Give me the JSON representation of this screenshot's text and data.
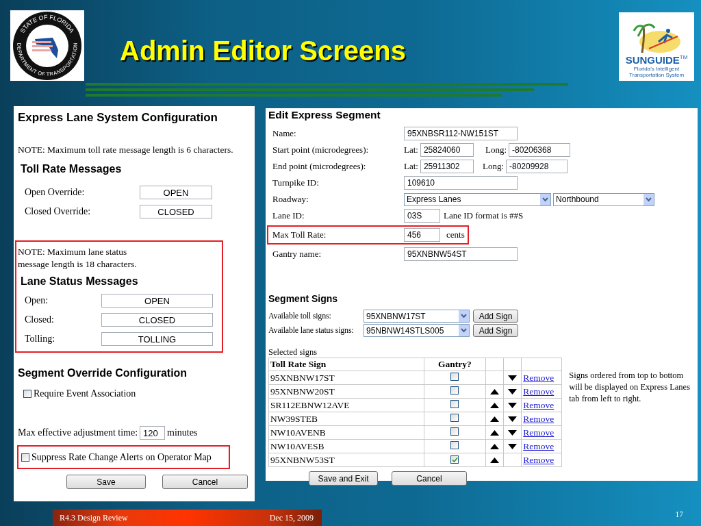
{
  "slide": {
    "title": "Admin Editor Screens",
    "footer_left": "R4.3 Design Review",
    "footer_date": "Dec 15, 2009",
    "page_number": "17"
  },
  "logos": {
    "left": {
      "top_text": "STATE OF FLORIDA",
      "bottom_text": "DEPARTMENT OF TRANSPORTATION"
    },
    "right": {
      "name": "SUNGUIDE",
      "trademark": "TM",
      "tagline": "Florida's Intelligent Transportation System"
    }
  },
  "system_config": {
    "title": "Express Lane System Configuration",
    "toll_note": "NOTE: Maximum toll rate message length is 6 characters.",
    "toll_heading": "Toll Rate Messages",
    "toll_messages": [
      {
        "label": "Open Override:",
        "value": "OPEN"
      },
      {
        "label": "Closed Override:",
        "value": "CLOSED"
      }
    ],
    "lane_highlighted": true,
    "lane_note": "NOTE: Maximum lane status message length is 18 characters.",
    "lane_heading": "Lane Status Messages",
    "lane_messages": [
      {
        "label": "Open:",
        "value": "OPEN"
      },
      {
        "label": "Closed:",
        "value": "CLOSED"
      },
      {
        "label": "Tolling:",
        "value": "TOLLING"
      }
    ],
    "override_heading": "Segment Override Configuration",
    "require_event": {
      "label": "Require Event Association",
      "checked": false
    },
    "adjust": {
      "label": "Max effective adjustment time:",
      "value": "120",
      "unit": "minutes"
    },
    "suppress": {
      "label": "Suppress Rate Change Alerts on Operator Map",
      "checked": false,
      "highlighted": true
    },
    "buttons": [
      "Save",
      "Cancel"
    ]
  },
  "segment": {
    "title": "Edit Express Segment",
    "fields": [
      {
        "kind": "text",
        "label": "Name:",
        "value": "95XNBSR112-NW151ST"
      },
      {
        "kind": "latlong",
        "label": "Start point (microdegrees):",
        "lat_label": "Lat:",
        "lat": "25824060",
        "long_label": "Long:",
        "long": "-80206368"
      },
      {
        "kind": "latlong",
        "label": "End point (microdegrees):",
        "lat_label": "Lat:",
        "lat": "25911302",
        "long_label": "Long:",
        "long": "-80209928"
      },
      {
        "kind": "text",
        "label": "Turnpike ID:",
        "value": "109610"
      },
      {
        "kind": "selects",
        "label": "Roadway:",
        "values": [
          "Express Lanes",
          "Northbound"
        ]
      },
      {
        "kind": "short",
        "label": "Lane ID:",
        "value": "03S",
        "hint": "Lane ID format is ##S",
        "highlighted": false
      },
      {
        "kind": "short",
        "label": "Max Toll Rate:",
        "value": "456",
        "hint": "cents",
        "highlighted": true
      },
      {
        "kind": "text",
        "label": "Gantry name:",
        "value": "95XNBNW54ST"
      }
    ],
    "signs_heading": "Segment Signs",
    "available": [
      {
        "label": "Available toll signs:",
        "value": "95XNBNW17ST",
        "button": "Add Sign"
      },
      {
        "label": "Available lane status signs:",
        "value": "95NBNW14STLS005",
        "button": "Add Sign"
      }
    ],
    "selected_caption": "Selected signs",
    "columns": [
      "Toll Rate Sign",
      "Gantry?"
    ],
    "rows": [
      {
        "name": "95XNBNW17ST",
        "gantry": false,
        "up": false,
        "down": true,
        "link": "Remove"
      },
      {
        "name": "95XNBNW20ST",
        "gantry": false,
        "up": true,
        "down": true,
        "link": "Remove"
      },
      {
        "name": "SR112EBNW12AVE",
        "gantry": false,
        "up": true,
        "down": true,
        "link": "Remove"
      },
      {
        "name": "NW39STEB",
        "gantry": false,
        "up": true,
        "down": true,
        "link": "Remove"
      },
      {
        "name": "NW10AVENB",
        "gantry": false,
        "up": true,
        "down": true,
        "link": "Remove"
      },
      {
        "name": "NW10AVESB",
        "gantry": false,
        "up": true,
        "down": true,
        "link": "Remove"
      },
      {
        "name": "95XNBNW53ST",
        "gantry": true,
        "up": true,
        "down": false,
        "link": "Remove"
      }
    ],
    "order_note": "Signs ordered from top to bottom will be displayed on Express Lanes tab from left to right.",
    "buttons": [
      "Save and Exit",
      "Cancel"
    ]
  }
}
